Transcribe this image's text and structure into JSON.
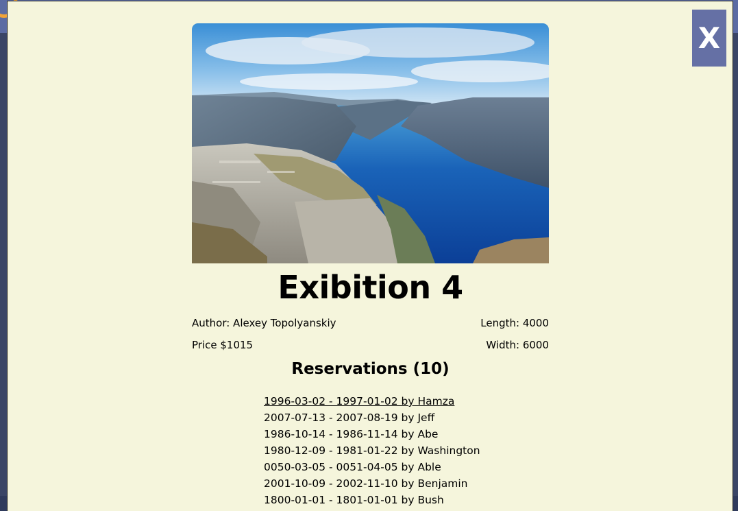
{
  "modal": {
    "close_label": "X",
    "image_alt": "Fjord landscape photograph",
    "title": "Exibition 4",
    "author": "Author: Alexey Topolyanskiy",
    "length": "Length: 4000",
    "price": "Price $1015",
    "width": "Width: 6000",
    "reservations_title": "Reservations (10)",
    "reservations": [
      "1996-03-02 - 1997-01-02 by Hamza",
      "2007-07-13 - 2007-08-19 by Jeff",
      "1986-10-14 - 1986-11-14 by Abe",
      "1980-12-09 - 1981-01-22 by Washington",
      "0050-03-05 - 0051-04-05 by Able",
      "2001-10-09 - 2002-11-10 by Benjamin",
      "1800-01-01 - 1801-01-01 by Bush"
    ]
  },
  "colors": {
    "modal_background": "#f5f5dc",
    "close_button": "#6570a5",
    "backdrop": "#3a4566",
    "accent_logo": "#f0a338"
  }
}
